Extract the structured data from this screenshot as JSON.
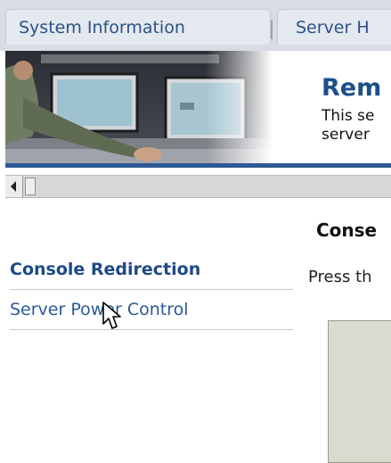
{
  "tabs": [
    {
      "label": "System Information"
    },
    {
      "label": "Server H"
    }
  ],
  "banner": {
    "title": "Rem",
    "desc_line1": "This se",
    "desc_line2": "server"
  },
  "nav": {
    "items": [
      {
        "label": "Console Redirection",
        "active": true
      },
      {
        "label": "Server Power Control",
        "active": false
      }
    ]
  },
  "main": {
    "title": "Conse",
    "instruction": "Press th"
  },
  "colors": {
    "accent": "#2c5a94",
    "link": "#2b5a96",
    "tab_text": "#2b5285"
  }
}
